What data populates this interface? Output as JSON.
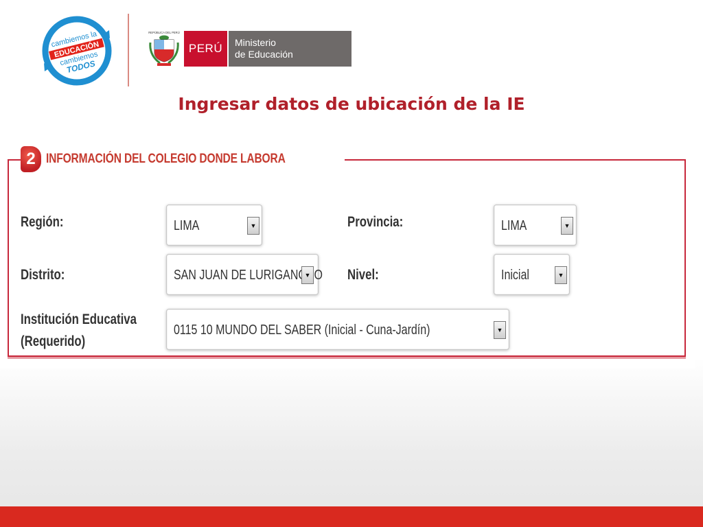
{
  "header": {
    "campaign_logo_text": "cambiemos la EDUCACIÓN cambiemos TODOS",
    "crest_caption": "REPÚBLICA DEL PERÚ",
    "peru_label": "PERÚ",
    "ministry_line1": "Ministerio",
    "ministry_line2": "de Educación",
    "colors": {
      "brand_red": "#c8102e",
      "ministry_gray": "#6e6a69",
      "logo_blue": "#1f8fd1"
    }
  },
  "page_title": "Ingresar datos de ubicación de la IE",
  "form": {
    "section_number": "2",
    "section_title": "INFORMACIÓN DEL COLEGIO DONDE LABORA",
    "fields": {
      "region": {
        "label": "Región:",
        "value": "LIMA"
      },
      "provincia": {
        "label": "Provincia:",
        "value": "LIMA"
      },
      "distrito": {
        "label": "Distrito:",
        "value": "SAN JUAN DE LURIGANCHO"
      },
      "nivel": {
        "label": "Nivel:",
        "value": "Inicial"
      },
      "institucion": {
        "label_line1": "Institución Educativa",
        "label_line2": "(Requerido)",
        "value": "0115 10 MUNDO DEL SABER (Inicial - Cuna-Jardín)"
      }
    },
    "dropdown_icon": "chevron-down-icon",
    "colors": {
      "frame_red": "#c7273a",
      "legend_red": "#c53a2f"
    }
  },
  "footer": {
    "bar_color": "#d9291f"
  }
}
